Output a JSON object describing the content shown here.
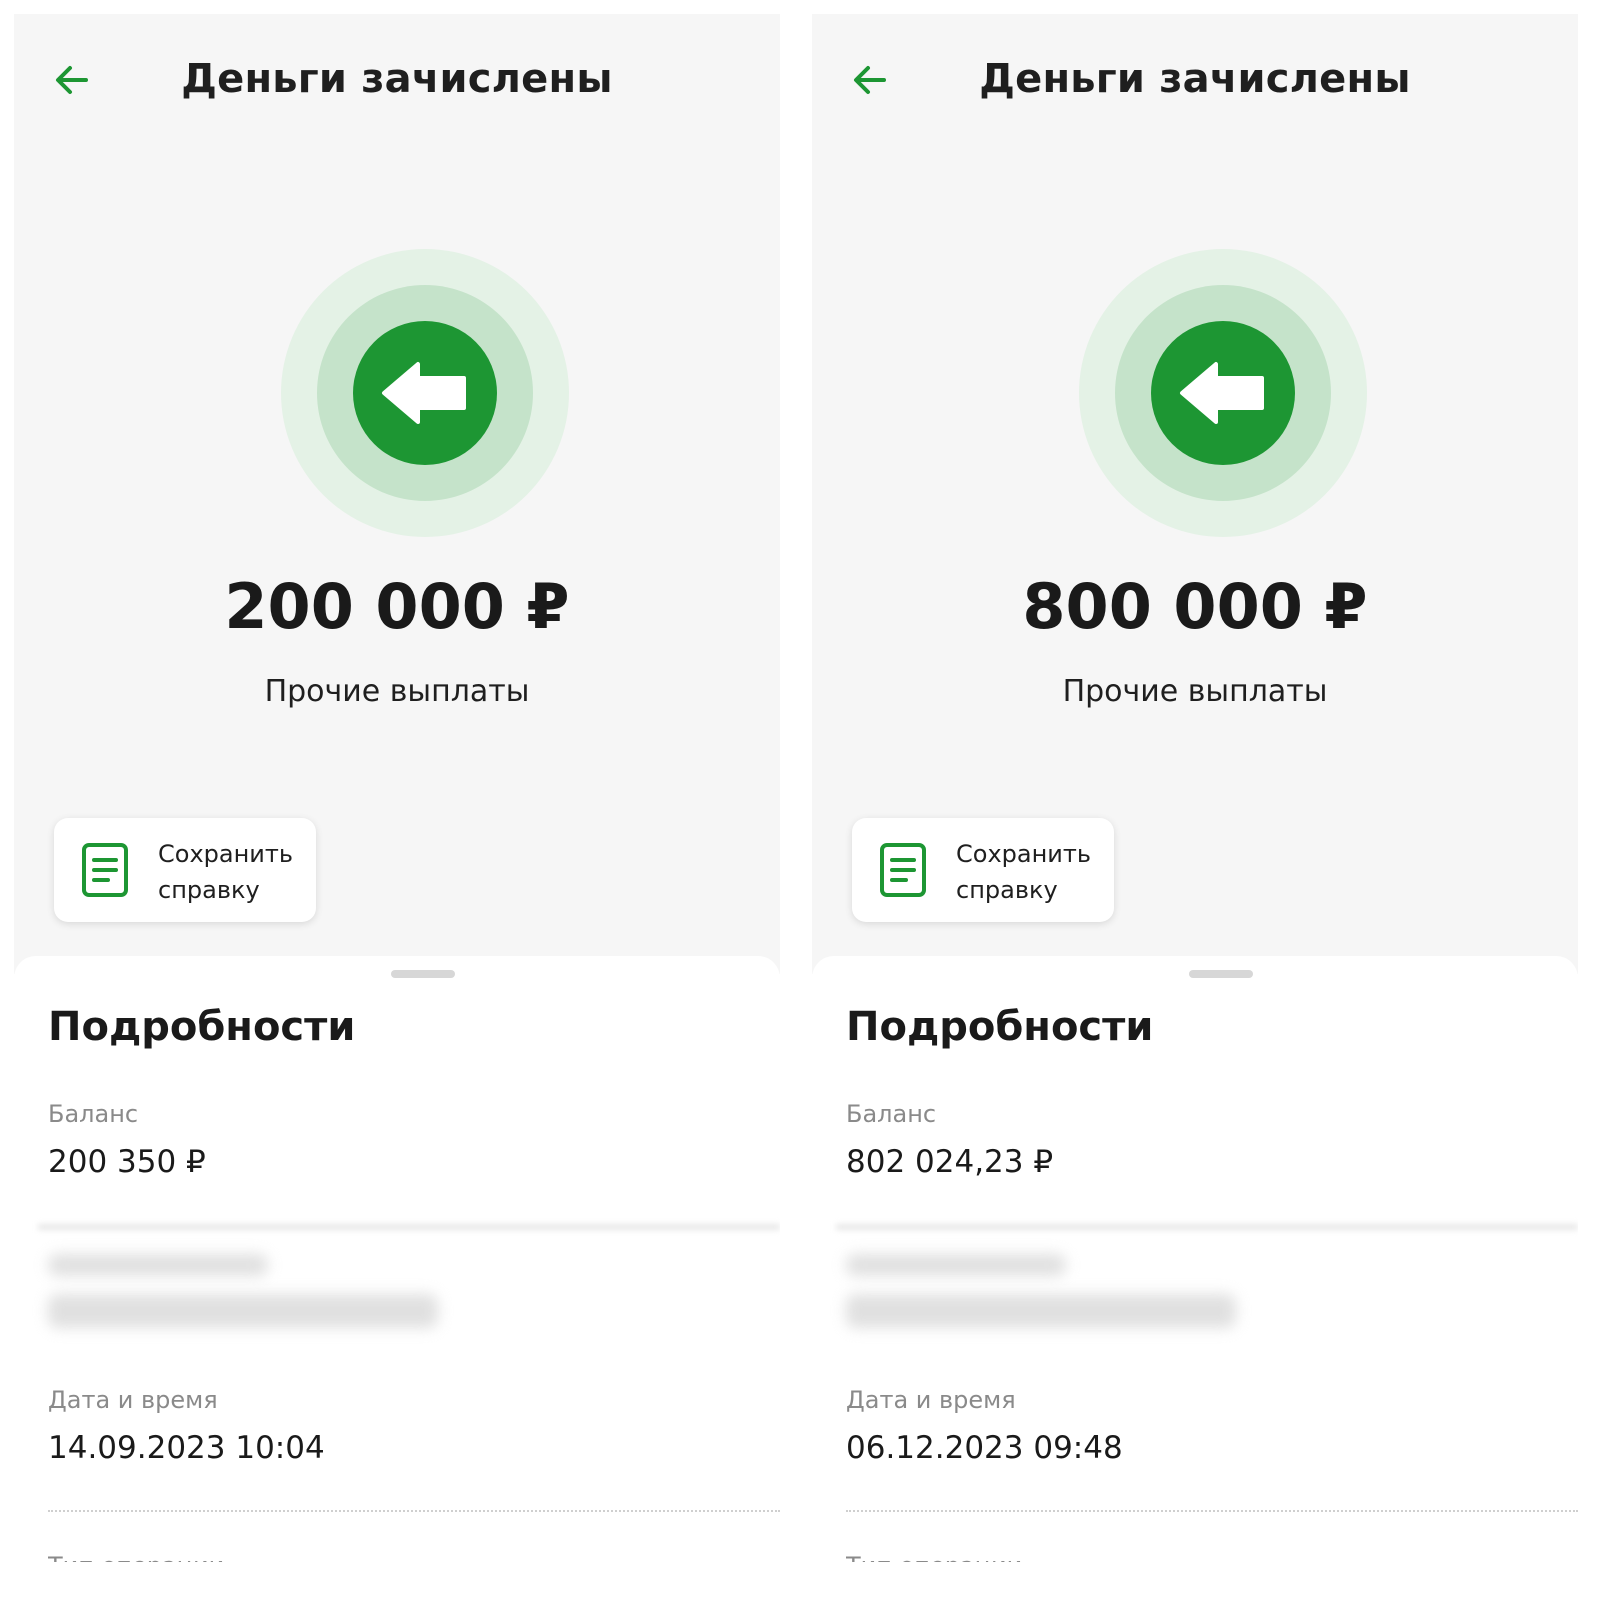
{
  "colors": {
    "accent": "#1d9633",
    "ring_inner": "#c5e3ca",
    "ring_outer": "#e4f2e6",
    "hero_background": "#f6f6f6"
  },
  "screens": [
    {
      "title": "Деньги зачислены",
      "back_icon": "arrow-left-icon",
      "status_icon": "incoming-arrow-icon",
      "amount": "200 000 ₽",
      "subtitle": "Прочие выплаты",
      "save_button": {
        "icon": "document-icon",
        "label": "Сохранить справку"
      },
      "details": {
        "title": "Подробности",
        "balance_label": "Баланс",
        "balance_value": "200 350 ₽",
        "datetime_label": "Дата и время",
        "datetime_value": "14.09.2023 10:04",
        "operation_type_label": "Тип операции"
      }
    },
    {
      "title": "Деньги зачислены",
      "back_icon": "arrow-left-icon",
      "status_icon": "incoming-arrow-icon",
      "amount": "800 000 ₽",
      "subtitle": "Прочие выплаты",
      "save_button": {
        "icon": "document-icon",
        "label": "Сохранить справку"
      },
      "details": {
        "title": "Подробности",
        "balance_label": "Баланс",
        "balance_value": "802 024,23 ₽",
        "datetime_label": "Дата и время",
        "datetime_value": "06.12.2023 09:48",
        "operation_type_label": "Тип операции"
      }
    }
  ]
}
